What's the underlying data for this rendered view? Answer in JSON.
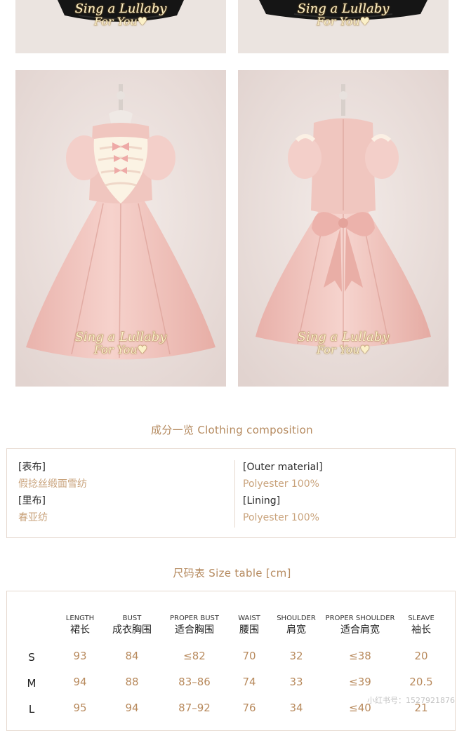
{
  "watermark": {
    "line1": "Sing a Lullaby",
    "line2": "For You♥"
  },
  "composition": {
    "title": "成分一览 Clothing composition",
    "left": [
      {
        "label": "[表布]",
        "value": "假捻丝缎面雪纺"
      },
      {
        "label": "[里布]",
        "value": "春亚纺"
      }
    ],
    "right": [
      {
        "label": "[Outer material]",
        "value": "Polyester 100%"
      },
      {
        "label": "[Lining]",
        "value": "Polyester 100%"
      }
    ]
  },
  "size_table": {
    "title": "尺码表 Size table [cm]",
    "headers": [
      {
        "en": "LENGTH",
        "cn": "裙长"
      },
      {
        "en": "BUST",
        "cn": "成衣胸围"
      },
      {
        "en": "PROPER BUST",
        "cn": "适合胸围"
      },
      {
        "en": "WAIST",
        "cn": "腰围"
      },
      {
        "en": "SHOULDER",
        "cn": "肩宽"
      },
      {
        "en": "PROPER SHOULDER",
        "cn": "适合肩宽"
      },
      {
        "en": "SLEAVE",
        "cn": "袖长"
      }
    ],
    "rows": [
      {
        "size": "S",
        "values": [
          "93",
          "84",
          "≤82",
          "70",
          "32",
          "≤38",
          "20"
        ]
      },
      {
        "size": "M",
        "values": [
          "94",
          "88",
          "83–86",
          "74",
          "33",
          "≤39",
          "20.5"
        ]
      },
      {
        "size": "L",
        "values": [
          "95",
          "94",
          "87–92",
          "76",
          "34",
          "≤40",
          "21"
        ]
      }
    ]
  },
  "overlay_watermark": "小红书号：1527921876",
  "colors": {
    "accent": "#b58a5f",
    "value": "#b88a5d",
    "border": "#e6d9cf",
    "dress_pink": "#f0c6bf"
  }
}
